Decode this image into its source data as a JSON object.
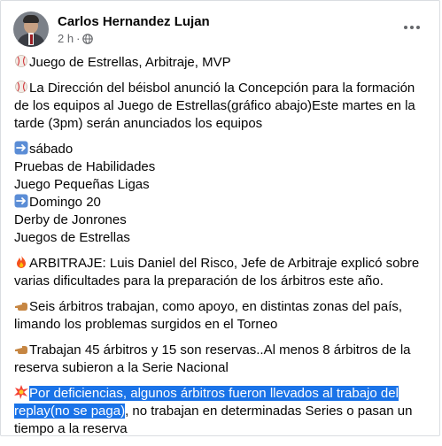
{
  "post": {
    "author": "Carlos Hernandez Lujan",
    "time": "2 h",
    "separator": "·",
    "privacy_icon": "globe-icon",
    "more_icon": "more-dots-icon"
  },
  "body": {
    "p1": "Juego de Estrellas, Arbitraje, MVP",
    "p2": {
      "l1": "La Dirección del béisbol anunció la Concepción para la formación",
      "l2": "de los equipos al Juego de Estrellas(gráfico abajo)Este martes en la",
      "l3": "tarde (3pm) serán anunciados los equipos"
    },
    "p3": {
      "l1": "sábado",
      "l2": "Pruebas de Habilidades",
      "l3": "Juego Pequeñas Ligas",
      "l4": "Domingo 20",
      "l5": "Derby de Jonrones",
      "l6": "Juegos de Estrellas"
    },
    "p4": {
      "l1": "ARBITRAJE: Luis Daniel del Risco, Jefe de Arbitraje explicó sobre",
      "l2": "varias dificultades para la preparación de los árbitros este año."
    },
    "p5": {
      "l1": "Seis árbitros trabajan, como apoyo, en distintas zonas del país,",
      "l2": "limando los problemas  surgidos en el Torneo"
    },
    "p6": {
      "l1": "Trabajan 45 árbitros y 15 son reservas..Al menos 8 árbitros de la",
      "l2": "reserva subieron a la Serie Nacional"
    },
    "p7": {
      "l1_selected": "Por deficiencias, algunos árbitros fueron llevados al trabajo del",
      "l2_selected": "replay(no se paga)",
      "l2_rest": ", no trabajan en determinadas Series o pasan un",
      "l3": "tiempo a la reserva"
    }
  },
  "icons": {
    "baseball": "baseball-icon",
    "arrow": "right-arrow-icon",
    "fire": "fire-icon",
    "hand": "pointing-hand-icon",
    "collision": "collision-icon"
  },
  "colors": {
    "selection": "#1a73e8",
    "meta": "#65676b",
    "arrow_box": "#5b8dd6"
  }
}
